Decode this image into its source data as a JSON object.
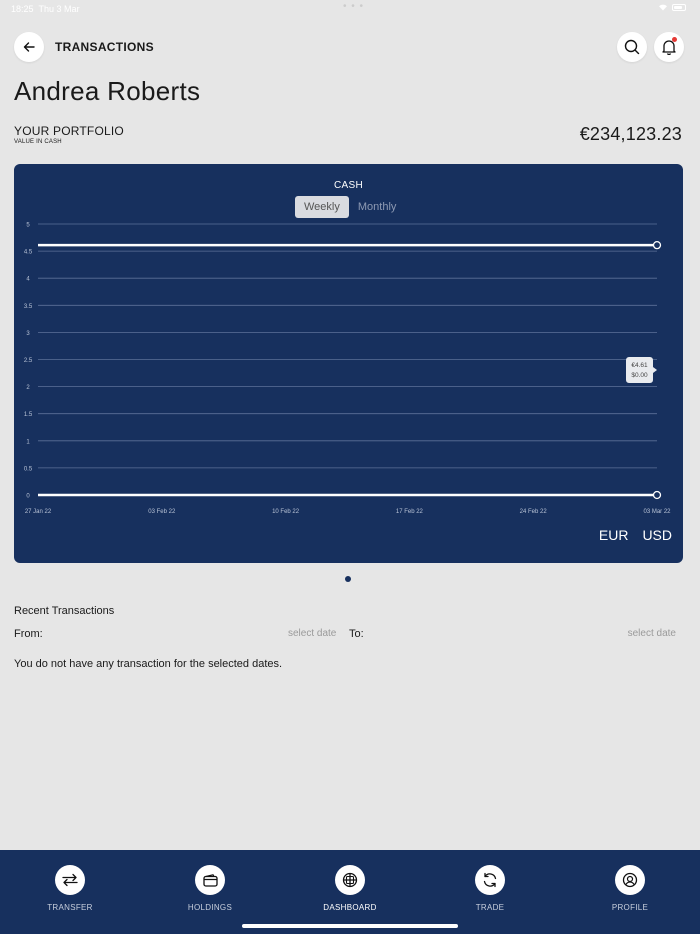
{
  "status_bar": {
    "time": "18:25",
    "date": "Thu 3 Mar",
    "dots": "• • •"
  },
  "header": {
    "title": "TRANSACTIONS",
    "back_icon": "arrow-left-icon",
    "search_icon": "search-icon",
    "bell_icon": "bell-icon"
  },
  "user": {
    "name": "Andrea Roberts"
  },
  "portfolio": {
    "label": "YOUR PORTFOLIO",
    "sublabel": "VALUE IN CASH",
    "value": "€234,123.23"
  },
  "chart_section": {
    "toggle": {
      "weekly": "Weekly",
      "monthly": "Monthly",
      "selected": "Weekly"
    },
    "currencies": [
      "EUR",
      "USD"
    ],
    "tooltip": {
      "line1": "€4.61",
      "line2": "$0.00"
    }
  },
  "chart_data": {
    "type": "line",
    "title": "CASH",
    "x": [
      "27 Jan 22",
      "03 Feb 22",
      "10 Feb 22",
      "17 Feb 22",
      "24 Feb 22",
      "03 Mar 22"
    ],
    "y_ticks": [
      "5",
      "4.5",
      "4",
      "3.5",
      "3",
      "2.5",
      "2",
      "1.5",
      "1",
      "0.5",
      "0"
    ],
    "ylim": [
      0,
      5
    ],
    "series": [
      {
        "values": [
          4.61,
          4.61,
          4.61,
          4.61,
          4.61,
          4.61
        ]
      },
      {
        "values": [
          0,
          0,
          0,
          0,
          0,
          0
        ]
      }
    ],
    "grid": true,
    "colors": {
      "background": "#17305e",
      "line": "#ffffff",
      "grid": "#5d7098"
    }
  },
  "transactions": {
    "title": "Recent Transactions",
    "from_label": "From:",
    "from_placeholder": "select date",
    "to_label": "To:",
    "to_placeholder": "select date",
    "empty_message": "You do not have any transaction for the selected dates."
  },
  "tabbar": {
    "items": [
      {
        "label": "TRANSFER",
        "icon": "transfer-icon"
      },
      {
        "label": "HOLDINGS",
        "icon": "wallet-icon"
      },
      {
        "label": "DASHBOARD",
        "icon": "dashboard-icon"
      },
      {
        "label": "TRADE",
        "icon": "refresh-icon"
      },
      {
        "label": "PROFILE",
        "icon": "profile-icon"
      }
    ],
    "active": "DASHBOARD"
  },
  "colors": {
    "primary": "#17305e",
    "background": "#e6e6e6",
    "notification": "#e53935"
  }
}
